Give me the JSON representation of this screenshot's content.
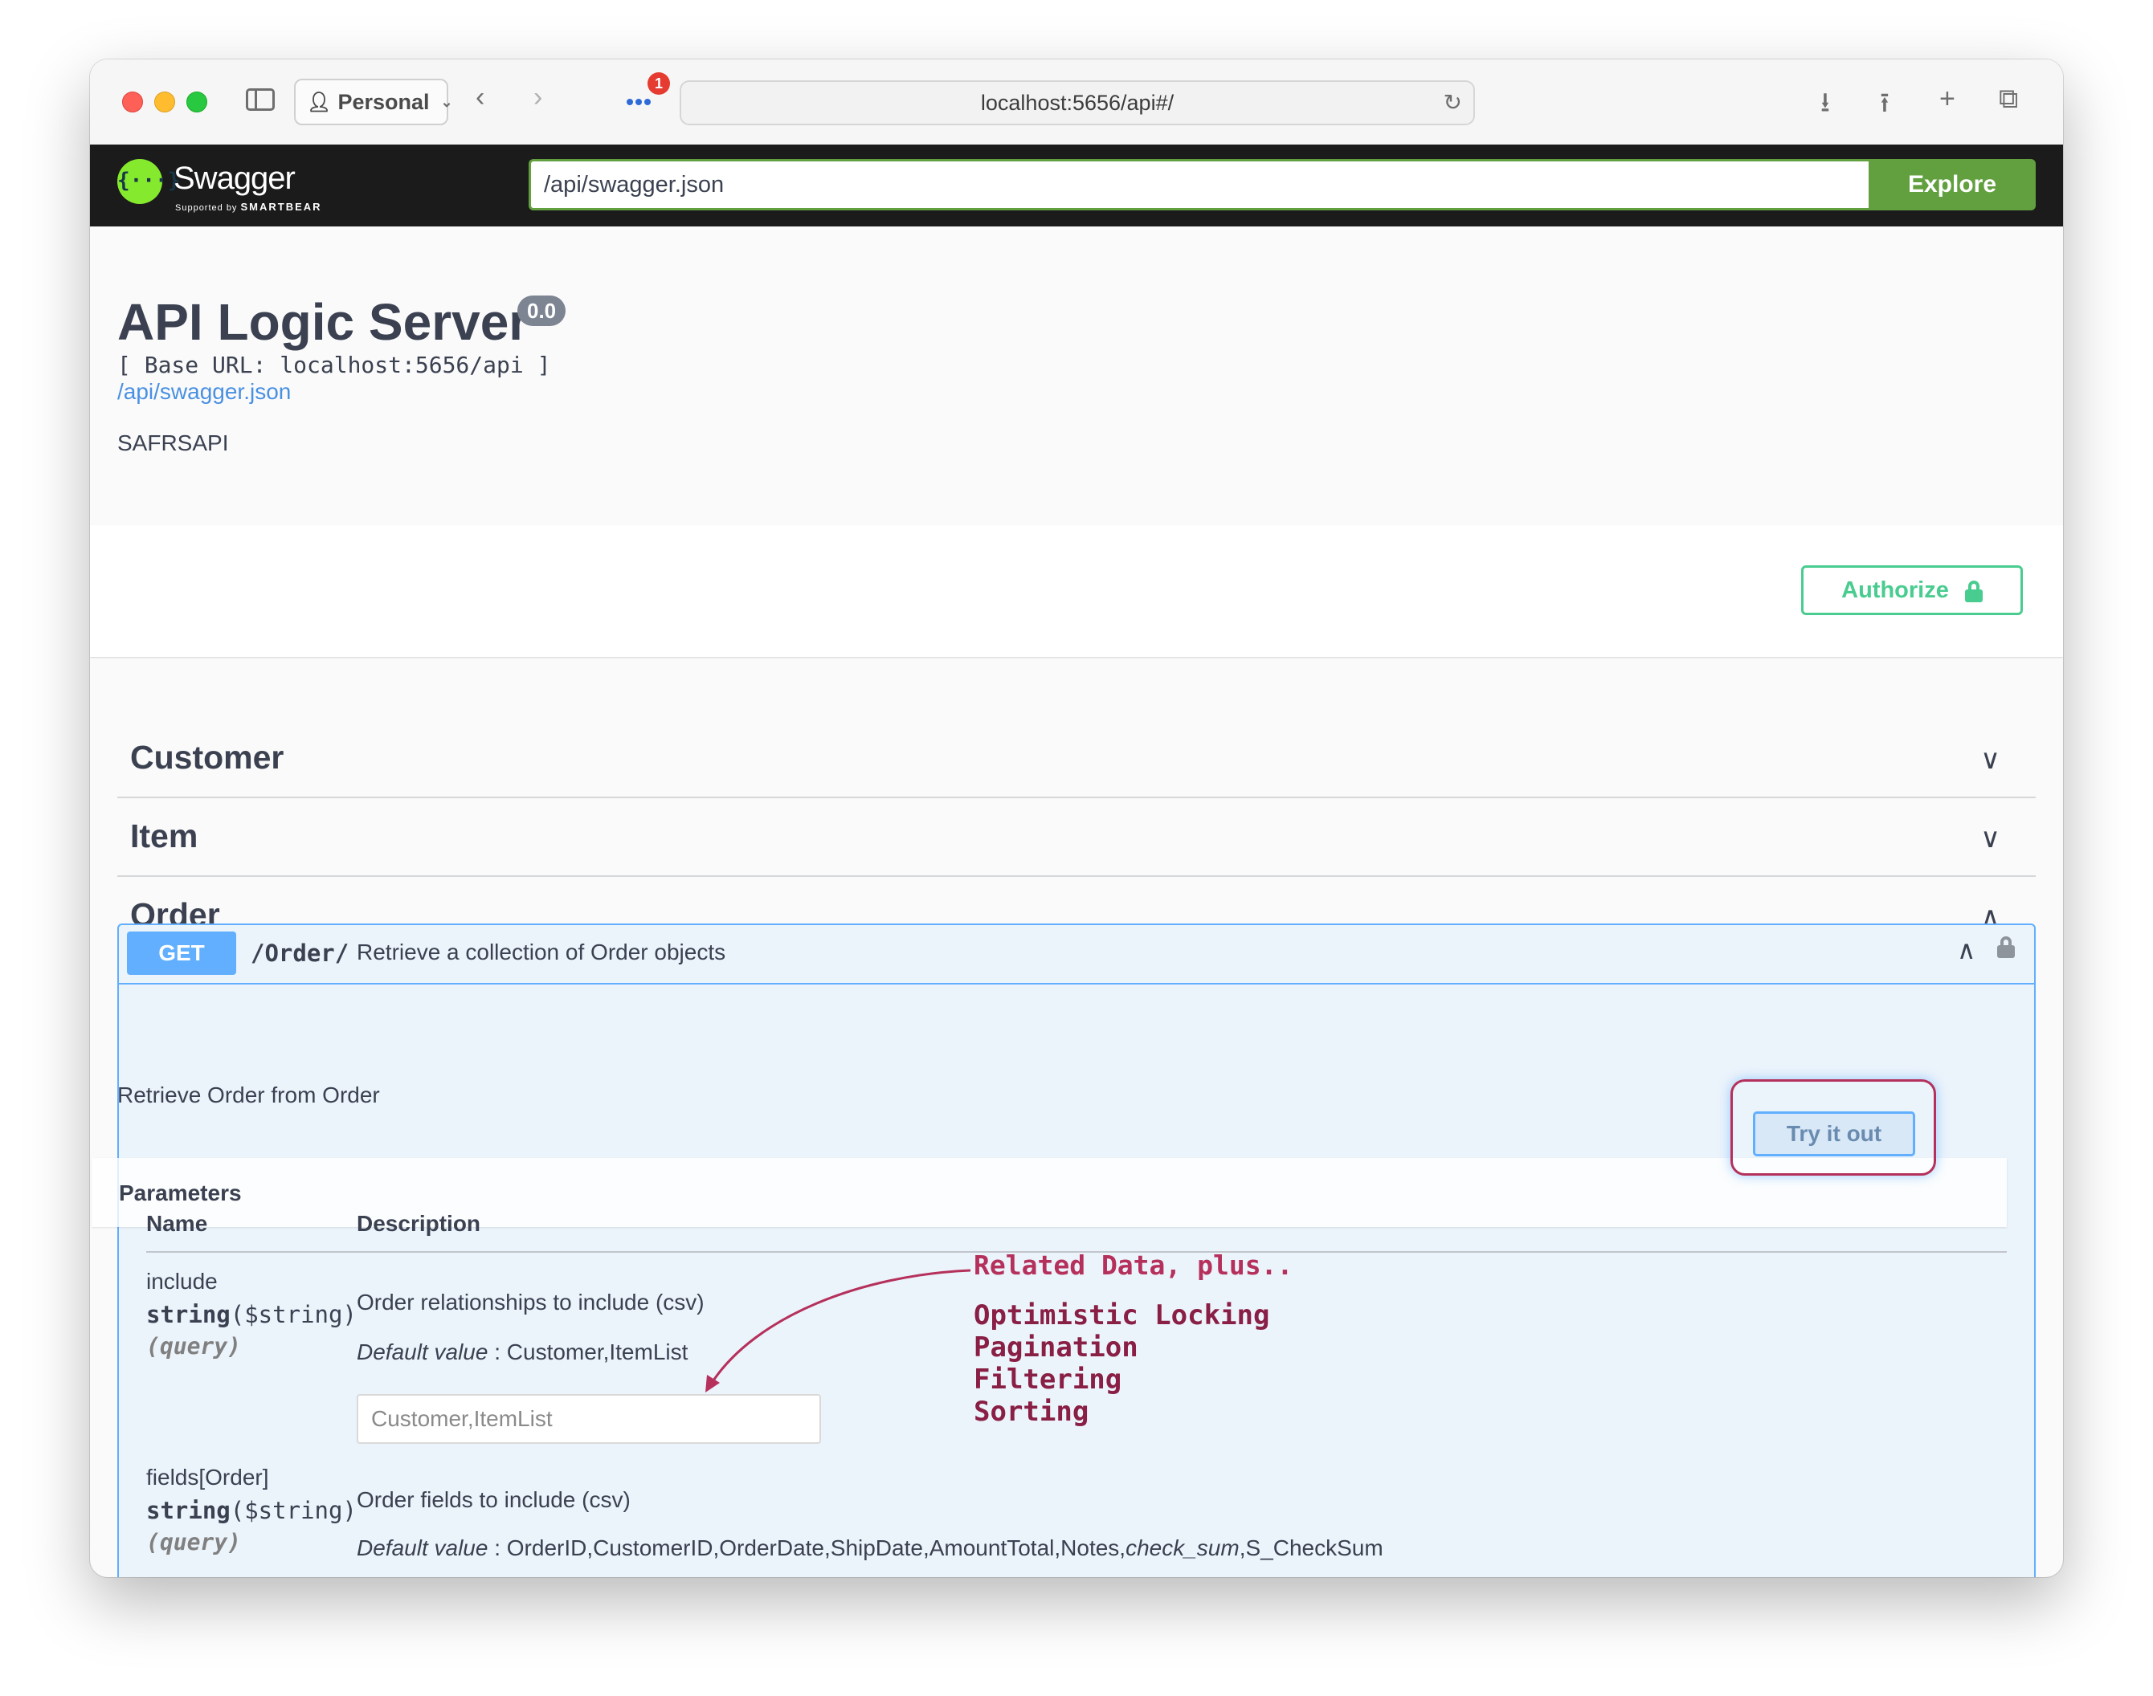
{
  "browser": {
    "profile_label": "Personal",
    "address": "localhost:5656/api#/",
    "extension_badge": "1",
    "icons": [
      "sidebar-icon",
      "person-icon",
      "chevron-down-icon",
      "back-arrow-icon",
      "forward-arrow-icon",
      "extension-icon",
      "reload-icon",
      "download-icon",
      "share-icon",
      "new-tab-icon",
      "tab-overview-icon"
    ]
  },
  "topbar": {
    "logo_text": "Swagger",
    "logo_glyph": "{···}",
    "logo_sub_prefix": "Supported by",
    "logo_sub_brand": "SMARTBEAR",
    "spec_url": "/api/swagger.json",
    "explore_label": "Explore"
  },
  "info": {
    "title": "API Logic Server",
    "version": "0.0",
    "base_url": "[ Base URL: localhost:5656/api ]",
    "spec_link": "/api/swagger.json",
    "description": "SAFRSAPI"
  },
  "authorize": {
    "label": "Authorize"
  },
  "tags": [
    {
      "name": "Customer",
      "chevron": "down"
    },
    {
      "name": "Item",
      "chevron": "down"
    },
    {
      "name": "Order",
      "chevron": "up"
    }
  ],
  "operation": {
    "method": "GET",
    "path": "/Order/",
    "summary": "Retrieve a collection of Order objects",
    "description": "Retrieve Order from Order",
    "parameters_title": "Parameters",
    "try_it_out_label": "Try it out",
    "columns": {
      "name": "Name",
      "description": "Description"
    },
    "parameters": [
      {
        "name": "include",
        "type": "string",
        "format": "($string)",
        "in": "(query)",
        "description": "Order relationships to include (csv)",
        "default_label": "Default value",
        "default_value": ": Customer,ItemList",
        "placeholder": "Customer,ItemList"
      },
      {
        "name": "fields[Order]",
        "type": "string",
        "format": "($string)",
        "in": "(query)",
        "description": "Order fields to include (csv)",
        "default_label": "Default value",
        "default_value_pre": ": OrderID,CustomerID,OrderDate,ShipDate,AmountTotal,Notes,",
        "default_value_italic": "check_sum",
        "default_value_post": ",S_CheckSum"
      }
    ]
  },
  "annotation": {
    "heading": "Related Data, plus..",
    "items": [
      "Optimistic Locking",
      "Pagination",
      "Filtering",
      "Sorting"
    ],
    "color": "#b5305b"
  },
  "colors": {
    "get_blue": "#61affe",
    "swagger_green": "#62a03f",
    "authorize_green": "#49cc90",
    "topbar_bg": "#1b1b1b"
  }
}
